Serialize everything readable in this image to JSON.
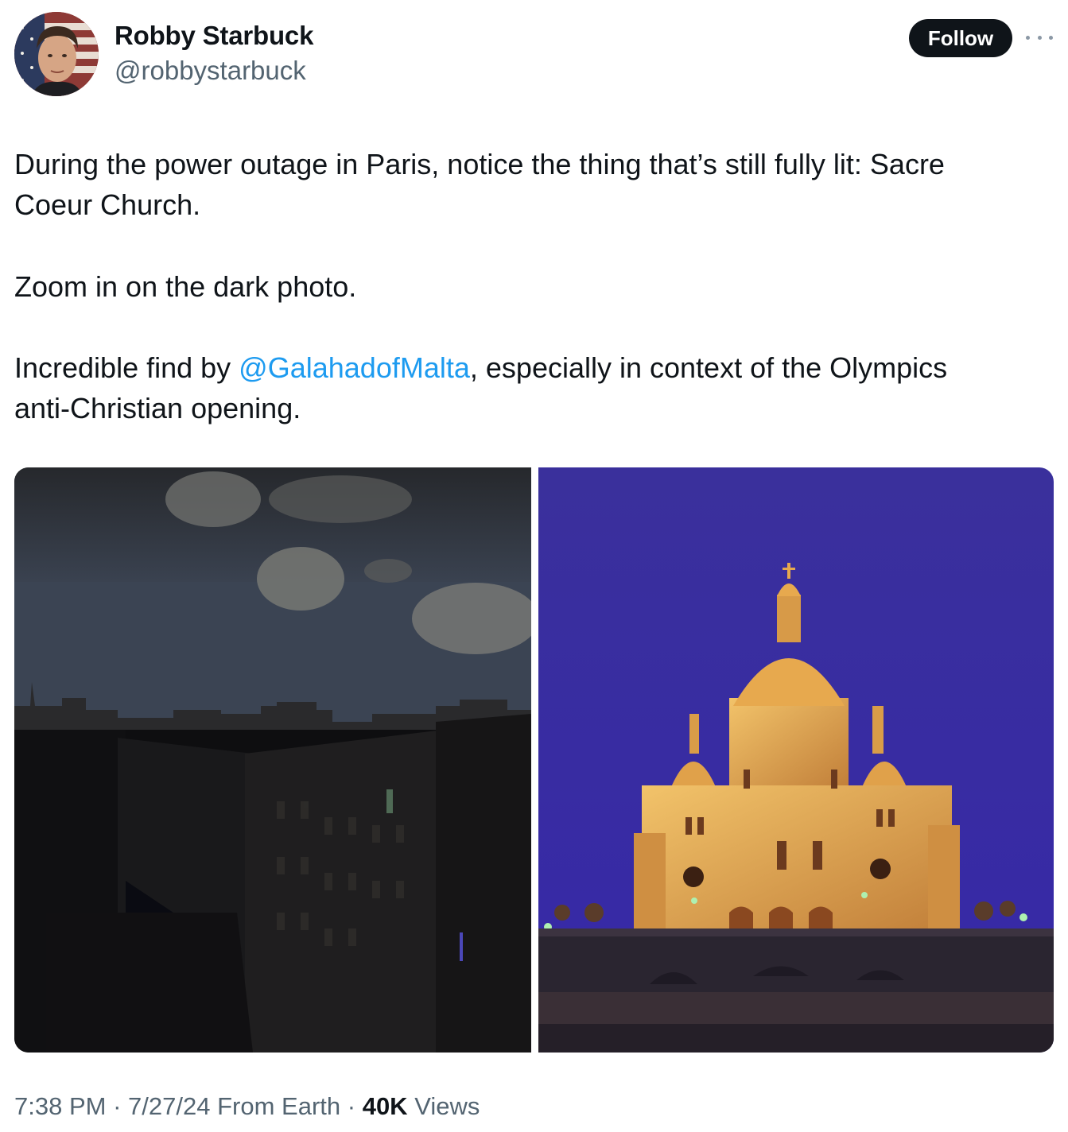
{
  "author": {
    "name": "Robby Starbuck",
    "handle": "@robbystarbuck",
    "avatar_icon": "user-avatar-flag-background"
  },
  "follow_label": "Follow",
  "more_icon": "more-horizontal-icon",
  "tweet": {
    "line1": "During the power outage in Paris, notice the thing that’s still fully lit: Sacre",
    "line2": "Coeur Church.",
    "line3": "Zoom in on the dark photo.",
    "line4_prefix": "Incredible find by ",
    "mention": "@GalahadofMalta",
    "line4_suffix": ", especially in context of the Olympics",
    "line5": "anti-Christian opening."
  },
  "media": [
    {
      "name": "dark-paris-photo"
    },
    {
      "name": "sacre-coeur-photo"
    }
  ],
  "meta": {
    "time": "7:38 PM",
    "date": "7/27/24",
    "source": "From Earth",
    "separator": "·",
    "views_count": "40K",
    "views_label": "Views"
  },
  "colors": {
    "text": "#0f1419",
    "secondary": "#536471",
    "link": "#1d9bf0",
    "button_bg": "#0f1419",
    "button_text": "#ffffff",
    "night_sky": "#3b2fa0",
    "church_gold": "#e7a94e"
  }
}
